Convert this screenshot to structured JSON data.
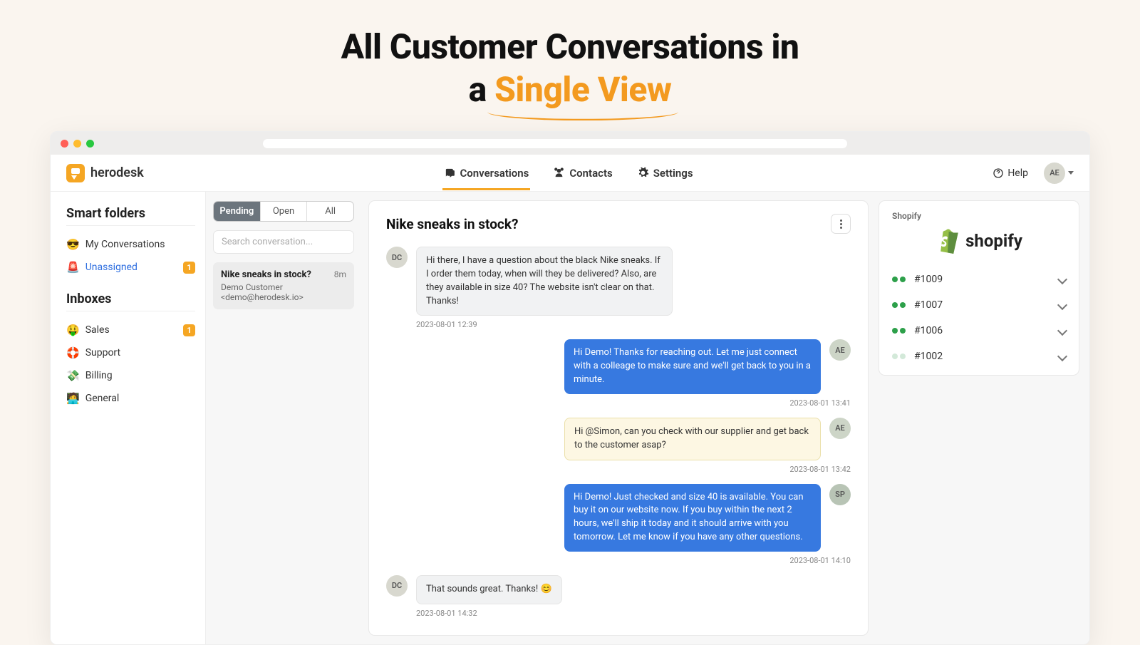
{
  "hero": {
    "line1": "All Customer Conversations in",
    "line2_pre": "a ",
    "line2_accent": "Single View"
  },
  "brand": {
    "name": "herodesk"
  },
  "nav": {
    "conversations": "Conversations",
    "contacts": "Contacts",
    "settings": "Settings",
    "help": "Help",
    "avatar": "AE"
  },
  "sidebar": {
    "smart_folders": "Smart folders",
    "items": [
      {
        "emoji": "😎",
        "label": "My Conversations",
        "badge": null,
        "selected": false
      },
      {
        "emoji": "🚨",
        "label": "Unassigned",
        "badge": "1",
        "selected": true
      }
    ],
    "inboxes": "Inboxes",
    "inbox_items": [
      {
        "emoji": "🤑",
        "label": "Sales",
        "badge": "1"
      },
      {
        "emoji": "🛟",
        "label": "Support",
        "badge": null
      },
      {
        "emoji": "💸",
        "label": "Billing",
        "badge": null
      },
      {
        "emoji": "🧑‍💻",
        "label": "General",
        "badge": null
      }
    ]
  },
  "convlist": {
    "tabs": {
      "pending": "Pending",
      "open": "Open",
      "all": "All"
    },
    "search_placeholder": "Search conversation...",
    "card": {
      "title": "Nike sneaks in stock?",
      "time": "8m",
      "sub": "Demo Customer <demo@herodesk.io>"
    }
  },
  "thread": {
    "title": "Nike sneaks in stock?",
    "messages": [
      {
        "side": "left",
        "avatar": "DC",
        "style": "grey",
        "text": "Hi there, I have a question about the black Nike sneaks. If I order them today, when will they be delivered? Also, are they available in size 40? The website isn't clear on that. Thanks!",
        "time": "2023-08-01 12:39"
      },
      {
        "side": "right",
        "avatar": "AE",
        "style": "blue",
        "av_class": "ae",
        "text": "Hi Demo! Thanks for reaching out. Let me just connect with a colleage to make sure and we'll get back to you in a minute.",
        "time": "2023-08-01 13:41"
      },
      {
        "side": "right",
        "avatar": "AE",
        "style": "note",
        "av_class": "ae",
        "text": "Hi @Simon, can you check with our supplier and get back to the customer asap?",
        "time": "2023-08-01 13:42"
      },
      {
        "side": "right",
        "avatar": "SP",
        "style": "blue",
        "av_class": "sp",
        "text": "Hi Demo! Just checked and size 40 is available. You can buy it on our website now. If you buy within the next 2 hours, we'll ship it today and it should arrive with you tomorrow. Let me know if you have any other questions.",
        "time": "2023-08-01 14:10"
      },
      {
        "side": "left",
        "avatar": "DC",
        "style": "grey",
        "text": "That sounds great. Thanks! 😊",
        "time": "2023-08-01 14:32"
      }
    ]
  },
  "shopify": {
    "label": "Shopify",
    "logo_text": "shopify",
    "orders": [
      {
        "id": "#1009",
        "faded": false
      },
      {
        "id": "#1007",
        "faded": false
      },
      {
        "id": "#1006",
        "faded": false
      },
      {
        "id": "#1002",
        "faded": true
      }
    ]
  }
}
